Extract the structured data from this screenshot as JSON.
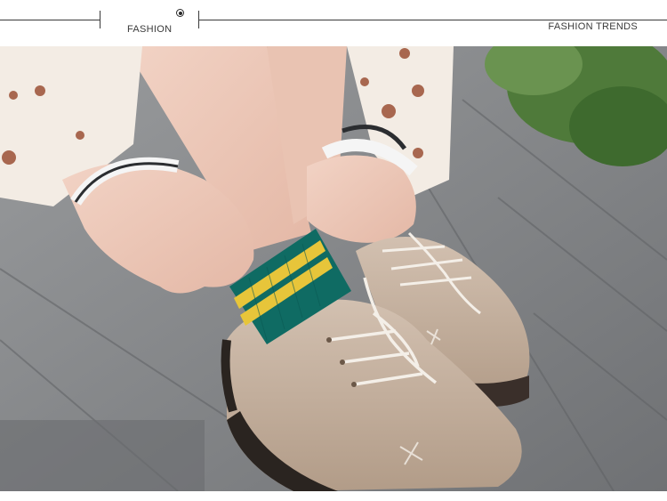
{
  "header": {
    "left_label": "FASHION",
    "right_label": "FASHION TRENDS"
  },
  "photo": {
    "subject": "photo-socks-shoes"
  },
  "colors": {
    "line": "#3a3a3a",
    "sock_teal": "#0f6b63",
    "sock_stripe": "#e7c53a",
    "shoe_suede": "#c8b4a2",
    "wood": "#8b8d8f"
  }
}
